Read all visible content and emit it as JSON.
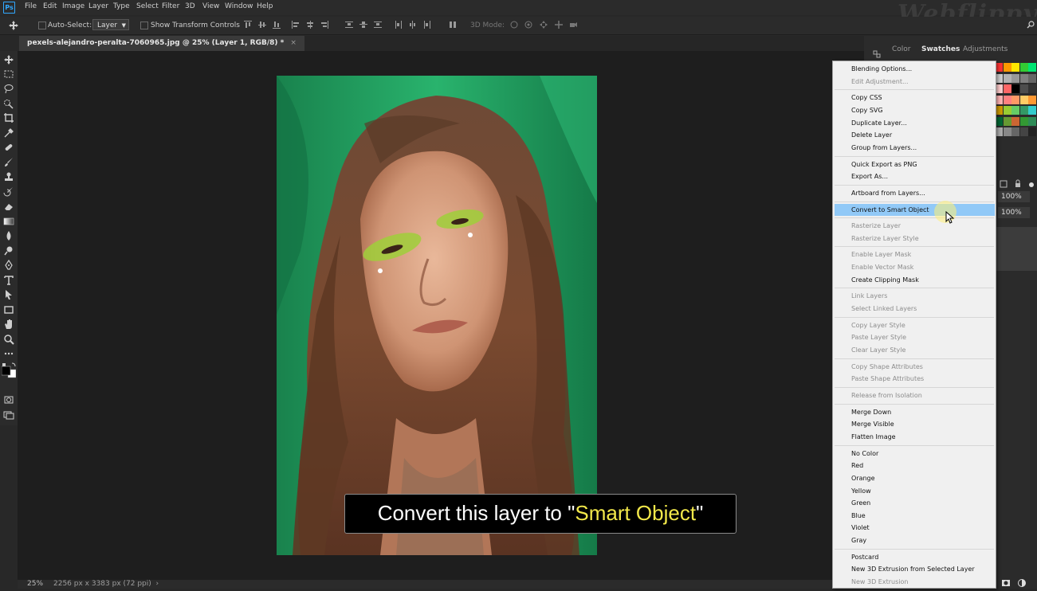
{
  "menubar": {
    "logo": "Ps",
    "items": [
      "File",
      "Edit",
      "Image",
      "Layer",
      "Type",
      "Select",
      "Filter",
      "3D",
      "View",
      "Window",
      "Help"
    ],
    "watermark": "Webflippy"
  },
  "options": {
    "auto_select_label": "Auto-Select:",
    "auto_select_value": "Layer",
    "show_transform_label": "Show Transform Controls",
    "mode_label": "3D Mode:"
  },
  "document": {
    "tab_title": "pexels-alejandro-peralta-7060965.jpg @ 25% (Layer 1, RGB/8) *",
    "close_glyph": "×"
  },
  "status": {
    "zoom": "25%",
    "doc_size": "2256 px x 3383 px (72 ppi)",
    "arrow": "›"
  },
  "caption": {
    "before": "Convert this layer to \"",
    "highlight": "Smart Object",
    "after": "\""
  },
  "panels": {
    "tabs": [
      "Color",
      "Swatches",
      "Adjustments"
    ],
    "active_tab": "Swatches",
    "opacity": "100%",
    "fill": "100%"
  },
  "context_menu": {
    "items": [
      {
        "label": "Blending Options...",
        "enabled": true
      },
      {
        "label": "Edit Adjustment...",
        "enabled": false
      },
      {
        "sep": true
      },
      {
        "label": "Copy CSS",
        "enabled": true
      },
      {
        "label": "Copy SVG",
        "enabled": true
      },
      {
        "label": "Duplicate Layer...",
        "enabled": true
      },
      {
        "label": "Delete Layer",
        "enabled": true
      },
      {
        "label": "Group from Layers...",
        "enabled": true
      },
      {
        "sep": true
      },
      {
        "label": "Quick Export as PNG",
        "enabled": true
      },
      {
        "label": "Export As...",
        "enabled": true
      },
      {
        "sep": true
      },
      {
        "label": "Artboard from Layers...",
        "enabled": true
      },
      {
        "sep": true
      },
      {
        "label": "Convert to Smart Object",
        "enabled": true,
        "highlighted": true
      },
      {
        "sep": true
      },
      {
        "label": "Rasterize Layer",
        "enabled": false
      },
      {
        "label": "Rasterize Layer Style",
        "enabled": false
      },
      {
        "sep": true
      },
      {
        "label": "Enable Layer Mask",
        "enabled": false
      },
      {
        "label": "Enable Vector Mask",
        "enabled": false
      },
      {
        "label": "Create Clipping Mask",
        "enabled": true
      },
      {
        "sep": true
      },
      {
        "label": "Link Layers",
        "enabled": false
      },
      {
        "label": "Select Linked Layers",
        "enabled": false
      },
      {
        "sep": true
      },
      {
        "label": "Copy Layer Style",
        "enabled": false
      },
      {
        "label": "Paste Layer Style",
        "enabled": false
      },
      {
        "label": "Clear Layer Style",
        "enabled": false
      },
      {
        "sep": true
      },
      {
        "label": "Copy Shape Attributes",
        "enabled": false
      },
      {
        "label": "Paste Shape Attributes",
        "enabled": false
      },
      {
        "sep": true
      },
      {
        "label": "Release from Isolation",
        "enabled": false
      },
      {
        "sep": true
      },
      {
        "label": "Merge Down",
        "enabled": true
      },
      {
        "label": "Merge Visible",
        "enabled": true
      },
      {
        "label": "Flatten Image",
        "enabled": true
      },
      {
        "sep": true
      },
      {
        "label": "No Color",
        "enabled": true
      },
      {
        "label": "Red",
        "enabled": true
      },
      {
        "label": "Orange",
        "enabled": true
      },
      {
        "label": "Yellow",
        "enabled": true
      },
      {
        "label": "Green",
        "enabled": true
      },
      {
        "label": "Blue",
        "enabled": true
      },
      {
        "label": "Violet",
        "enabled": true
      },
      {
        "label": "Gray",
        "enabled": true
      },
      {
        "sep": true
      },
      {
        "label": "Postcard",
        "enabled": true
      },
      {
        "label": "New 3D Extrusion from Selected Layer",
        "enabled": true
      },
      {
        "label": "New 3D Extrusion",
        "enabled": false
      }
    ]
  },
  "colors": {
    "highlight": "#91c9f7",
    "caption_highlight": "#f2e84a",
    "ps_blue": "#31a8ff"
  }
}
